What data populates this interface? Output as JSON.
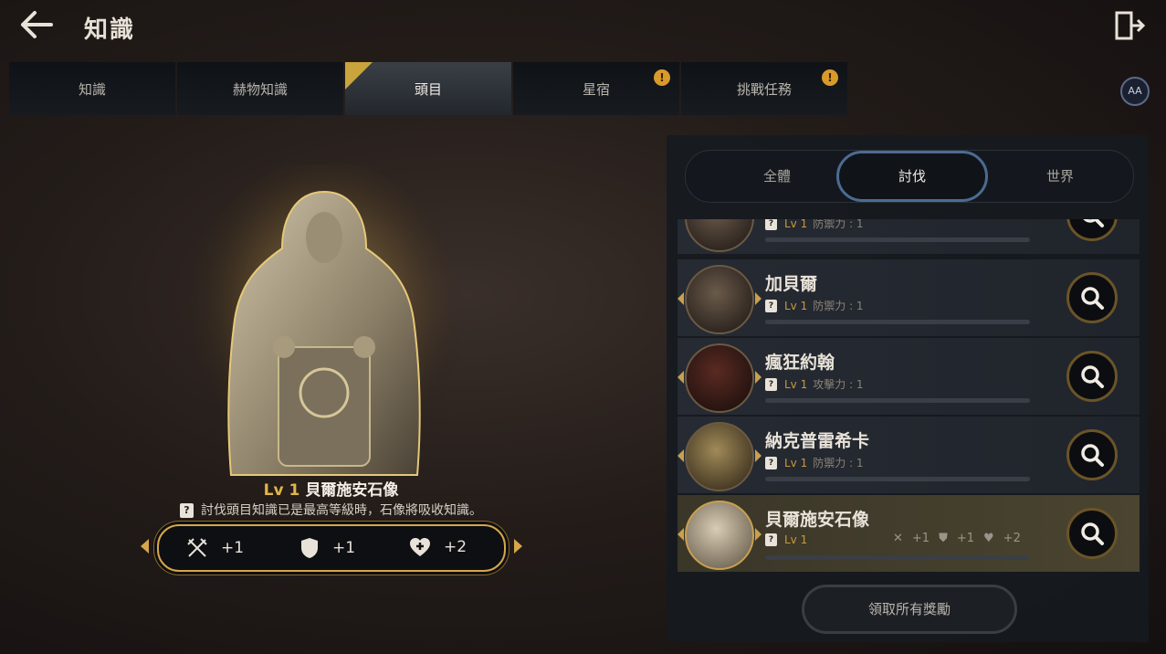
{
  "header": {
    "title": "知識"
  },
  "tabs": [
    {
      "label": "知識",
      "active": false,
      "badge": null
    },
    {
      "label": "赫物知識",
      "active": false,
      "badge": null
    },
    {
      "label": "頭目",
      "active": true,
      "badge": null
    },
    {
      "label": "星宿",
      "active": false,
      "badge": "!"
    },
    {
      "label": "挑戰任務",
      "active": false,
      "badge": "!"
    }
  ],
  "help_label": "AA",
  "detail": {
    "level": "Lv 1",
    "name": "貝爾施安石像",
    "description": "討伐頭目知識已是最高等級時，石像將吸收知識。",
    "stats": [
      {
        "icon": "swords-icon",
        "value": "+1"
      },
      {
        "icon": "shield-icon",
        "value": "+1"
      },
      {
        "icon": "heart-plus-icon",
        "value": "+2"
      }
    ]
  },
  "filters": [
    {
      "label": "全體",
      "active": false
    },
    {
      "label": "討伐",
      "active": true
    },
    {
      "label": "世界",
      "active": false
    }
  ],
  "boss_list": [
    {
      "name": "",
      "level": "Lv 1",
      "effect": "防禦力 : 1",
      "selected": false
    },
    {
      "name": "加貝爾",
      "level": "Lv 1",
      "effect": "防禦力 : 1",
      "selected": false
    },
    {
      "name": "瘋狂約翰",
      "level": "Lv 1",
      "effect": "攻擊力 : 1",
      "selected": false
    },
    {
      "name": "納克普雷希卡",
      "level": "Lv 1",
      "effect": "防禦力 : 1",
      "selected": false
    },
    {
      "name": "貝爾施安石像",
      "level": "Lv 1",
      "effect": "",
      "selected": true,
      "stats": [
        "+1",
        "+1",
        "+2"
      ]
    }
  ],
  "claim_button": "領取所有獎勵",
  "colors": {
    "gold": "#d6a64a",
    "accent_blue": "#4d6b92",
    "badge": "#d89a2a"
  }
}
